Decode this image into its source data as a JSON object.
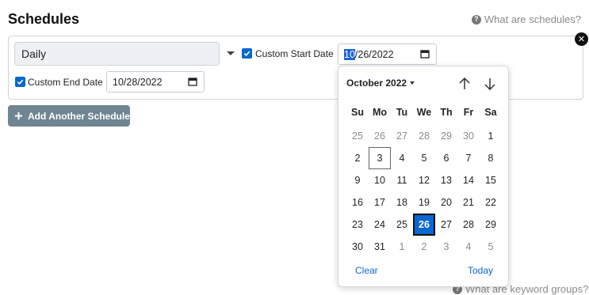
{
  "page": {
    "title": "Schedules"
  },
  "help_top": {
    "label": "What are schedules?",
    "icon": "question-circle-icon"
  },
  "schedule": {
    "frequency": "Daily",
    "custom_start": {
      "label": "Custom Start Date",
      "checked": true,
      "value_month": "10",
      "value_rest": "/26/2022"
    },
    "custom_end": {
      "label": "Custom End Date",
      "checked": true,
      "value": "10/28/2022"
    }
  },
  "add_button": {
    "label": "Add Another Schedule",
    "icon": "plus-icon"
  },
  "help_bottom": {
    "label": "What are keyword groups?",
    "icon": "question-circle-icon"
  },
  "picker": {
    "month_label": "October 2022",
    "weekdays": [
      "Su",
      "Mo",
      "Tu",
      "We",
      "Th",
      "Fr",
      "Sa"
    ],
    "weeks": [
      [
        {
          "d": "25",
          "o": true
        },
        {
          "d": "26",
          "o": true
        },
        {
          "d": "27",
          "o": true
        },
        {
          "d": "28",
          "o": true
        },
        {
          "d": "29",
          "o": true
        },
        {
          "d": "30",
          "o": true
        },
        {
          "d": "1"
        }
      ],
      [
        {
          "d": "2"
        },
        {
          "d": "3",
          "today": true
        },
        {
          "d": "4"
        },
        {
          "d": "5"
        },
        {
          "d": "6"
        },
        {
          "d": "7"
        },
        {
          "d": "8"
        }
      ],
      [
        {
          "d": "9"
        },
        {
          "d": "10"
        },
        {
          "d": "11"
        },
        {
          "d": "12"
        },
        {
          "d": "13"
        },
        {
          "d": "14"
        },
        {
          "d": "15"
        }
      ],
      [
        {
          "d": "16"
        },
        {
          "d": "17"
        },
        {
          "d": "18"
        },
        {
          "d": "19"
        },
        {
          "d": "20"
        },
        {
          "d": "21"
        },
        {
          "d": "22"
        }
      ],
      [
        {
          "d": "23"
        },
        {
          "d": "24"
        },
        {
          "d": "25"
        },
        {
          "d": "26",
          "selected": true
        },
        {
          "d": "27"
        },
        {
          "d": "28"
        },
        {
          "d": "29"
        }
      ],
      [
        {
          "d": "30"
        },
        {
          "d": "31"
        },
        {
          "d": "1",
          "o": true
        },
        {
          "d": "2",
          "o": true
        },
        {
          "d": "3",
          "o": true
        },
        {
          "d": "4",
          "o": true
        },
        {
          "d": "5",
          "o": true
        }
      ]
    ],
    "clear_label": "Clear",
    "today_label": "Today"
  },
  "colors": {
    "accent": "#0a66d1",
    "button": "#6f8591"
  }
}
